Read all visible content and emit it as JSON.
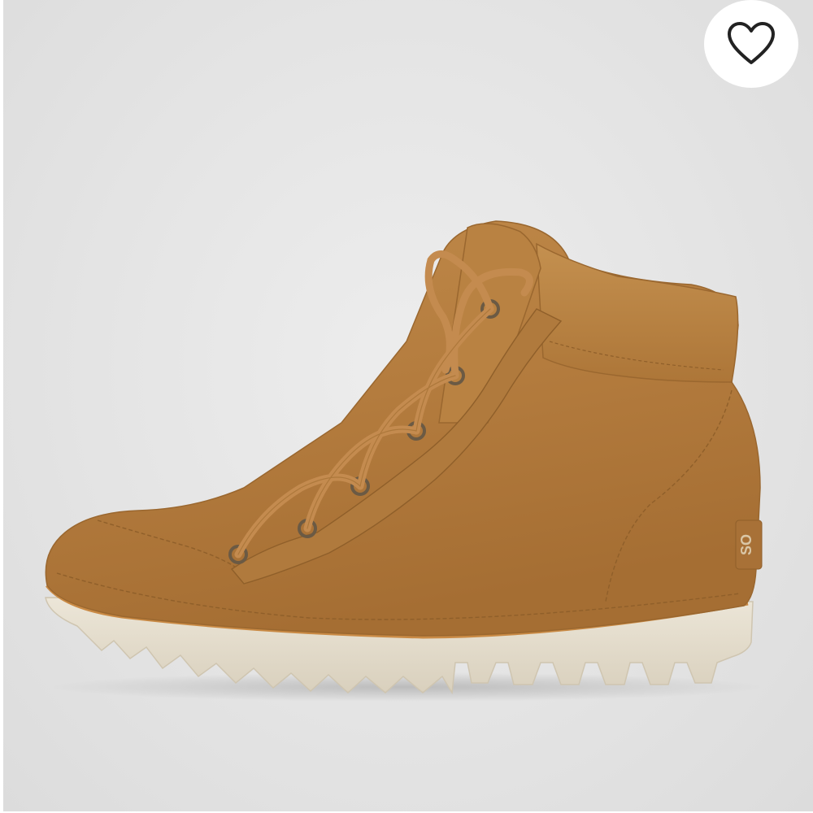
{
  "product": {
    "image_subject": "tan-leather-hiking-boot",
    "heel_tab_text": "SO"
  },
  "favorite": {
    "icon": "heart-outline-icon",
    "state": "not-favorited"
  },
  "colors": {
    "background": "#e6e6e6",
    "leather": "#b47e40",
    "sole": "#e4dccb",
    "icon": "#222222"
  }
}
